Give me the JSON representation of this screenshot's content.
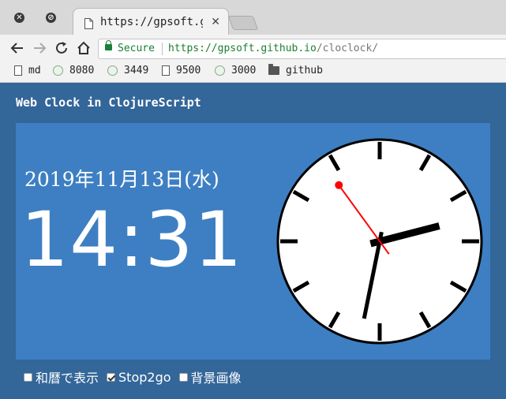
{
  "browser": {
    "tab_title": "https://gpsoft.github.io",
    "secure_label": "Secure",
    "url_host": "https://gpsoft.github.io",
    "url_path": "/cloclock/",
    "bookmarks": [
      {
        "label": "md",
        "icon": "page-icon"
      },
      {
        "label": "8080",
        "icon": "globe-icon"
      },
      {
        "label": "3449",
        "icon": "globe-icon"
      },
      {
        "label": "9500",
        "icon": "page-icon"
      },
      {
        "label": "3000",
        "icon": "globe-icon"
      },
      {
        "label": "github",
        "icon": "folder-icon"
      }
    ]
  },
  "page": {
    "title": "Web Clock in ClojureScript",
    "date": "2019年11月13日(水)",
    "time": "14:31"
  },
  "clock": {
    "hour": 14,
    "minute": 31,
    "second": 54,
    "face_color": "#ffffff",
    "second_hand_color": "#ff0000",
    "background_color": "#3d7fc2"
  },
  "options": [
    {
      "label": "和暦で表示",
      "checked": false
    },
    {
      "label": "Stop2go",
      "checked": true
    },
    {
      "label": "背景画像",
      "checked": false
    }
  ]
}
